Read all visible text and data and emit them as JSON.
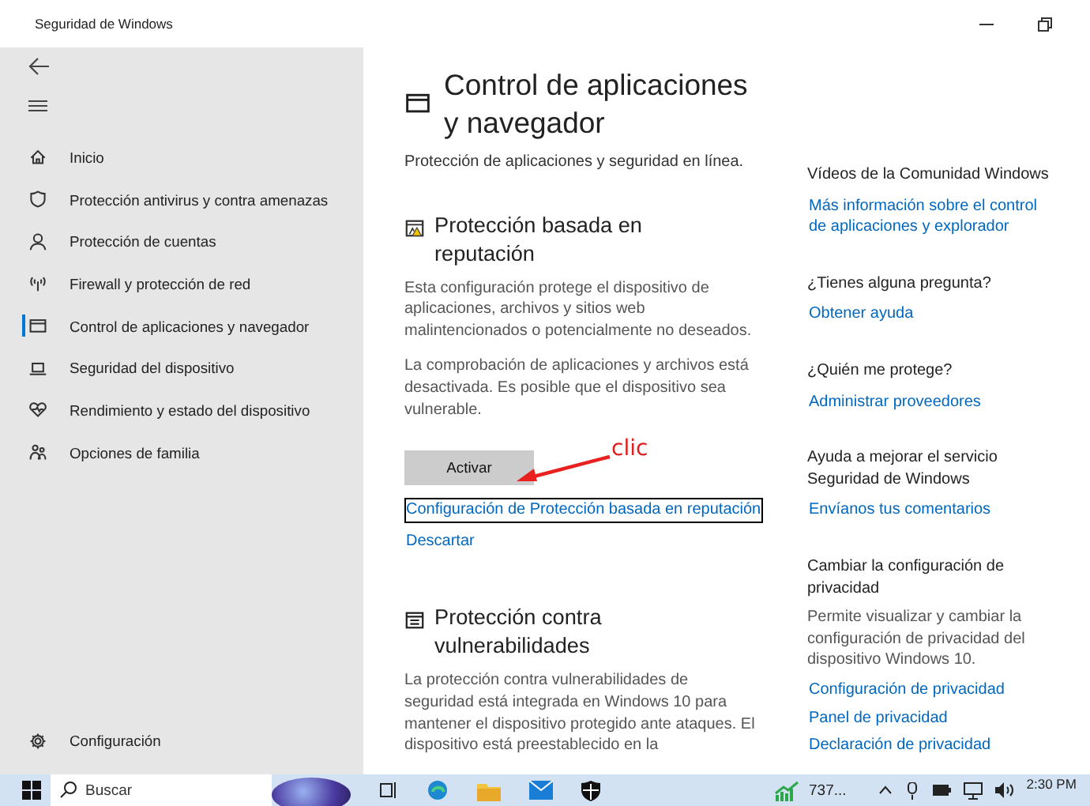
{
  "window": {
    "title": "Seguridad de Windows"
  },
  "sidebar": {
    "items": [
      {
        "label": "Inicio",
        "selected": false
      },
      {
        "label": "Protección antivirus y contra amenazas",
        "selected": false
      },
      {
        "label": "Protección de cuentas",
        "selected": false
      },
      {
        "label": "Firewall y protección de red",
        "selected": false
      },
      {
        "label": "Control de aplicaciones y navegador",
        "selected": true
      },
      {
        "label": "Seguridad del dispositivo",
        "selected": false
      },
      {
        "label": "Rendimiento y estado del dispositivo",
        "selected": false
      },
      {
        "label": "Opciones de familia",
        "selected": false
      }
    ],
    "footer": {
      "label": "Configuración"
    }
  },
  "main": {
    "title": "Control de aplicaciones y navegador",
    "subtitle": "Protección de aplicaciones y seguridad en línea.",
    "sections": [
      {
        "heading": "Protección basada en reputación",
        "paragraphs": [
          "Esta configuración protege el dispositivo de aplicaciones, archivos y sitios web malintencionados o potencialmente no deseados.",
          "La comprobación de aplicaciones y archivos está desactivada. Es posible que el dispositivo sea vulnerable."
        ],
        "button": "Activar",
        "links": [
          {
            "text": "Configuración de Protección basada en reputación",
            "focused": true
          },
          {
            "text": "Descartar",
            "focused": false
          }
        ]
      },
      {
        "heading": "Protección contra vulnerabilidades",
        "paragraphs": [
          "La protección contra vulnerabilidades de seguridad está integrada en Windows 10 para mantener el dispositivo protegido ante ataques. El dispositivo está preestablecido en la"
        ]
      }
    ]
  },
  "annotation": {
    "text": "clic"
  },
  "aside": {
    "groups": [
      {
        "heading": "Vídeos de la Comunidad Windows",
        "links": [
          "Más información sobre el control de aplicaciones y explorador"
        ]
      },
      {
        "heading": "¿Tienes alguna pregunta?",
        "links": [
          "Obtener ayuda"
        ]
      },
      {
        "heading": "¿Quién me protege?",
        "links": [
          "Administrar proveedores"
        ]
      },
      {
        "heading": "Ayuda a mejorar el servicio Seguridad de Windows",
        "links": [
          "Envíanos tus comentarios"
        ]
      },
      {
        "heading": "Cambiar la configuración de privacidad",
        "text": "Permite visualizar y cambiar la configuración de privacidad del dispositivo Windows 10.",
        "links": [
          "Configuración de privacidad",
          "Panel de privacidad",
          "Declaración de privacidad"
        ]
      }
    ]
  },
  "taskbar": {
    "search_placeholder": "Buscar",
    "widget": "737...",
    "time": "2:30 PM"
  }
}
